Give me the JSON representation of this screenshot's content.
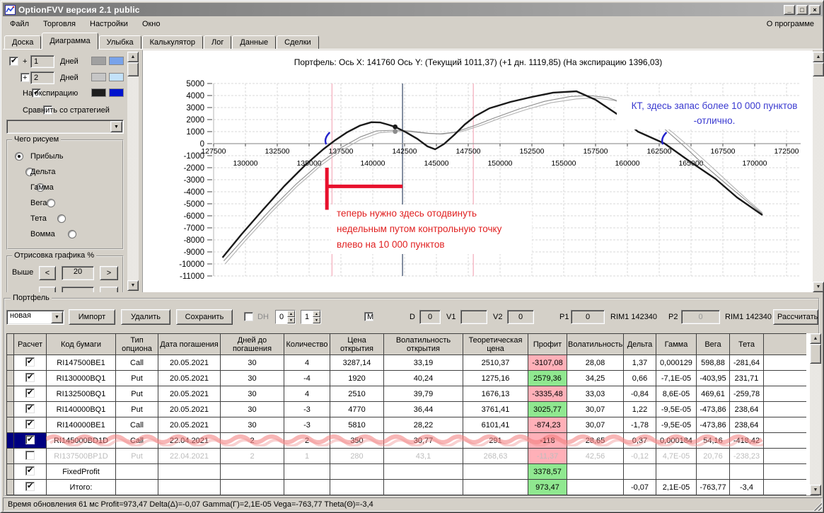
{
  "window": {
    "title": "OptionFVV версия 2.1 public"
  },
  "icons": {
    "minimize": "_",
    "maximize": "□",
    "close": "×",
    "combo_arrow": "▼",
    "spin_up": "▲",
    "spin_down": "▼",
    "scroll_up": "▲",
    "scroll_down": "▼"
  },
  "menu": {
    "items": [
      "Файл",
      "Торговля",
      "Настройки",
      "Окно"
    ],
    "right": "О программе"
  },
  "tabs": {
    "items": [
      "Доска",
      "Диаграмма",
      "Улыбка",
      "Калькулятор",
      "Лог",
      "Данные",
      "Сделки"
    ],
    "active": "Диаграмма"
  },
  "left_panel": {
    "day1": {
      "checked": true,
      "plus": "+",
      "value": "1",
      "label": "Дней",
      "swatch1": "#a0a0a0",
      "swatch2": "#79a3ea"
    },
    "day2": {
      "checked": false,
      "plus": "+",
      "value": "2",
      "label": "Дней",
      "swatch1": "#c6c6c6",
      "swatch2": "#c3e2fa"
    },
    "expiration": {
      "checked": true,
      "label": "На экспирацию",
      "swatch1": "#1e1e1e",
      "swatch2": "#0013cd"
    },
    "compare": {
      "checked": false,
      "label": "Сравнить со стратегией"
    },
    "strategy_combo_value": "",
    "draw_group": {
      "title": "Чего рисуем",
      "options": [
        "Прибыль",
        "Дельта",
        "Гамма",
        "Вега",
        "Тета",
        "Вомма"
      ],
      "selected": "Прибыль"
    },
    "render_group": {
      "title": "Отрисовка графика %",
      "above_label": "Выше",
      "above_value": "20",
      "dec": "<",
      "inc": ">"
    }
  },
  "chart_data": {
    "type": "line",
    "title": "Портфель: Ось X: 141760 Ось Y:  (Текущий 1011,37)  (+1 дн. 1119,85)  (На экспирацию 1396,03)",
    "xlim": [
      127500,
      172500
    ],
    "ylim": [
      -11000,
      5000
    ],
    "grid": true,
    "x_ticks": [
      127500,
      130000,
      132500,
      135000,
      137500,
      140000,
      142500,
      145000,
      147500,
      150000,
      152500,
      155000,
      157500,
      160000,
      162500,
      165000,
      167500,
      170000,
      172500
    ],
    "y_ticks": [
      5000,
      4000,
      3000,
      2000,
      1000,
      0,
      -1000,
      -2000,
      -3000,
      -4000,
      -5000,
      -6000,
      -7000,
      -8000,
      -9000,
      -10000,
      -11000
    ],
    "current_x": 141760,
    "series": [
      {
        "name": "Текущий",
        "color": "#b3b3b3",
        "width": 1.1,
        "points": [
          [
            128400,
            -10000
          ],
          [
            130000,
            -8050
          ],
          [
            132000,
            -5750
          ],
          [
            134000,
            -3600
          ],
          [
            136000,
            -1750
          ],
          [
            137500,
            -600
          ],
          [
            139000,
            320
          ],
          [
            140500,
            900
          ],
          [
            141760,
            1011
          ],
          [
            143000,
            985
          ],
          [
            144400,
            840
          ],
          [
            145500,
            790
          ],
          [
            147000,
            1010
          ],
          [
            148500,
            1520
          ],
          [
            150000,
            2120
          ],
          [
            152000,
            2820
          ],
          [
            154000,
            3400
          ],
          [
            156000,
            3720
          ],
          [
            157500,
            3800
          ],
          [
            159000,
            3580
          ],
          [
            160500,
            3040
          ],
          [
            162000,
            2160
          ],
          [
            163500,
            980
          ],
          [
            165000,
            -380
          ],
          [
            166500,
            -1820
          ],
          [
            168000,
            -3280
          ],
          [
            169700,
            -4920
          ],
          [
            170610,
            -5750
          ]
        ]
      },
      {
        "name": "+1 дн.",
        "color": "#8c8c8c",
        "width": 1.1,
        "points": [
          [
            128300,
            -9750
          ],
          [
            130000,
            -7750
          ],
          [
            132000,
            -5450
          ],
          [
            134000,
            -3350
          ],
          [
            136000,
            -1500
          ],
          [
            137500,
            -350
          ],
          [
            139000,
            550
          ],
          [
            140300,
            1060
          ],
          [
            141760,
            1120
          ],
          [
            143000,
            1040
          ],
          [
            144400,
            860
          ],
          [
            145300,
            810
          ],
          [
            146500,
            960
          ],
          [
            148000,
            1500
          ],
          [
            149500,
            2120
          ],
          [
            151500,
            2880
          ],
          [
            153500,
            3520
          ],
          [
            155500,
            3920
          ],
          [
            157000,
            4000
          ],
          [
            158500,
            3820
          ],
          [
            160000,
            3280
          ],
          [
            161500,
            2380
          ],
          [
            163000,
            1150
          ],
          [
            164500,
            -250
          ],
          [
            166000,
            -1750
          ],
          [
            167800,
            -3380
          ],
          [
            169500,
            -4880
          ],
          [
            170610,
            -5850
          ]
        ]
      },
      {
        "name": "На экспирацию",
        "color": "#1a1a1a",
        "width": 2.4,
        "points": [
          [
            128200,
            -9470
          ],
          [
            129700,
            -7530
          ],
          [
            131400,
            -5470
          ],
          [
            133050,
            -3530
          ],
          [
            134720,
            -1760
          ],
          [
            136110,
            -470
          ],
          [
            137000,
            250
          ],
          [
            138000,
            950
          ],
          [
            139000,
            1500
          ],
          [
            139900,
            1780
          ],
          [
            140600,
            1760
          ],
          [
            141200,
            1580
          ],
          [
            141760,
            1396
          ],
          [
            142600,
            950
          ],
          [
            143500,
            400
          ],
          [
            144300,
            -230
          ],
          [
            144900,
            -470
          ],
          [
            145600,
            -30
          ],
          [
            146400,
            730
          ],
          [
            147220,
            1590
          ],
          [
            148060,
            2290
          ],
          [
            149170,
            2940
          ],
          [
            150830,
            3470
          ],
          [
            152500,
            3880
          ],
          [
            154170,
            4240
          ],
          [
            156000,
            4350
          ],
          [
            157500,
            3650
          ],
          [
            159170,
            2470
          ],
          [
            160830,
            1000
          ],
          [
            162940,
            0
          ],
          [
            164720,
            -1350
          ],
          [
            166940,
            -2940
          ],
          [
            168610,
            -4470
          ],
          [
            170610,
            -5940
          ]
        ]
      }
    ],
    "markers": [
      {
        "x": 141760,
        "y": 1396,
        "color": "#1a1a1a"
      },
      {
        "x": 141760,
        "y": 1011,
        "color": "#8c8c8c"
      }
    ],
    "vlines": [
      {
        "x": 136800,
        "color": "#f5b6c3"
      },
      {
        "x": 147900,
        "color": "#f5b6c3"
      },
      {
        "x": 142340,
        "color": "#50607a"
      }
    ],
    "kt_marks": [
      136350,
      162800
    ],
    "move_marker": {
      "x": 136400,
      "y_top": -2000,
      "y_bottom": -5500,
      "y_h": -3550,
      "x_end": 142340,
      "color": "#e8112d"
    },
    "red_note": {
      "color": "#e02020",
      "lines": [
        "теперь нужно здесь отодвинуть",
        "недельным путом контрольную точку",
        "влево на 10 000 пунктов"
      ]
    },
    "blue_note": {
      "color": "#3a3ad0",
      "lines": [
        "КТ, здесь запас более 10 000 пунктов",
        "-отлично."
      ]
    }
  },
  "portfolio": {
    "group_title": "Портфель",
    "name_combo_value": "новая",
    "import_label": "Импорт",
    "delete_label": "Удалить",
    "save_label": "Сохранить",
    "dh_label": "DH",
    "dh_spin1": "0",
    "dh_spin2": "1",
    "m_label": "M",
    "d_label": "D",
    "d_value": "0",
    "v1_label": "V1",
    "v1_value": "",
    "v2_label": "V2",
    "v2_value": "0",
    "p1_label": "P1",
    "p1_value": "0",
    "rim1_label": "RIM1 142340",
    "p2_label": "P2",
    "p2_value": "0",
    "rim2_label": "RIM1 142340",
    "calc_label": "Рассчитать"
  },
  "table": {
    "headers": [
      "Расчет",
      "Код бумаги",
      "Тип опциона",
      "Дата погашения",
      "Дней до погашения",
      "Количество",
      "Цена открытия",
      "Волатильность открытия",
      "Теоретическая цена",
      "Профит",
      "Волатильность",
      "Дельта",
      "Гамма",
      "Вега",
      "Тета"
    ],
    "rows": [
      {
        "checked": true,
        "selected": false,
        "disabled": false,
        "scribble": false,
        "profit": "red",
        "cells": [
          "RI147500BE1",
          "Call",
          "20.05.2021",
          "30",
          "4",
          "3287,14",
          "33,19",
          "2510,37",
          "-3107,08",
          "28,08",
          "1,37",
          "0,000129",
          "598,88",
          "-281,64"
        ]
      },
      {
        "checked": true,
        "selected": false,
        "disabled": false,
        "scribble": false,
        "profit": "green",
        "cells": [
          "RI130000BQ1",
          "Put",
          "20.05.2021",
          "30",
          "-4",
          "1920",
          "40,24",
          "1275,16",
          "2579,36",
          "34,25",
          "0,66",
          "-7,1E-05",
          "-403,95",
          "231,71"
        ]
      },
      {
        "checked": true,
        "selected": false,
        "disabled": false,
        "scribble": false,
        "profit": "red",
        "cells": [
          "RI132500BQ1",
          "Put",
          "20.05.2021",
          "30",
          "4",
          "2510",
          "39,79",
          "1676,13",
          "-3335,48",
          "33,03",
          "-0,84",
          "8,6E-05",
          "469,61",
          "-259,78"
        ]
      },
      {
        "checked": true,
        "selected": false,
        "disabled": false,
        "scribble": false,
        "profit": "green",
        "cells": [
          "RI140000BQ1",
          "Put",
          "20.05.2021",
          "30",
          "-3",
          "4770",
          "36,44",
          "3761,41",
          "3025,77",
          "30,07",
          "1,22",
          "-9,5E-05",
          "-473,86",
          "238,64"
        ]
      },
      {
        "checked": true,
        "selected": false,
        "disabled": false,
        "scribble": false,
        "profit": "red",
        "cells": [
          "RI140000BE1",
          "Call",
          "20.05.2021",
          "30",
          "-3",
          "5810",
          "28,22",
          "6101,41",
          "-874,23",
          "30,07",
          "-1,78",
          "-9,5E-05",
          "-473,86",
          "238,64"
        ]
      },
      {
        "checked": true,
        "selected": true,
        "disabled": false,
        "scribble": true,
        "profit": "red",
        "cells": [
          "RI145000BD1D",
          "Call",
          "22.04.2021",
          "2",
          "2",
          "350",
          "30,77",
          "291",
          "-118",
          "28,65",
          "0,37",
          "0,000184",
          "54,16",
          "-418,42"
        ]
      },
      {
        "checked": false,
        "selected": false,
        "disabled": true,
        "scribble": false,
        "profit": "red",
        "cells": [
          "RI137500BP1D",
          "Put",
          "22.04.2021",
          "2",
          "1",
          "280",
          "43,1",
          "268,63",
          "-11,37",
          "42,56",
          "-0,12",
          "4,7E-05",
          "20,76",
          "-238,23"
        ]
      },
      {
        "checked": true,
        "selected": false,
        "disabled": false,
        "scribble": false,
        "profit": "green",
        "cells": [
          "FixedProfit",
          "",
          "",
          "",
          "",
          "",
          "",
          "",
          "3378,57",
          "",
          "",
          "",
          "",
          ""
        ]
      },
      {
        "checked": true,
        "selected": false,
        "disabled": false,
        "scribble": false,
        "profit": "green",
        "cells": [
          "Итого:",
          "",
          "",
          "",
          "",
          "",
          "",
          "",
          "973,47",
          "",
          "-0,07",
          "2,1E-05",
          "-763,77",
          "-3,4"
        ]
      }
    ]
  },
  "status_bar": {
    "text": "Время обновления 61 мс  Profit=973,47 Delta(Δ)=-0,07 Gamma(Γ)=2,1E-05 Vega=-763,77 Theta(Θ)=-3,4"
  }
}
